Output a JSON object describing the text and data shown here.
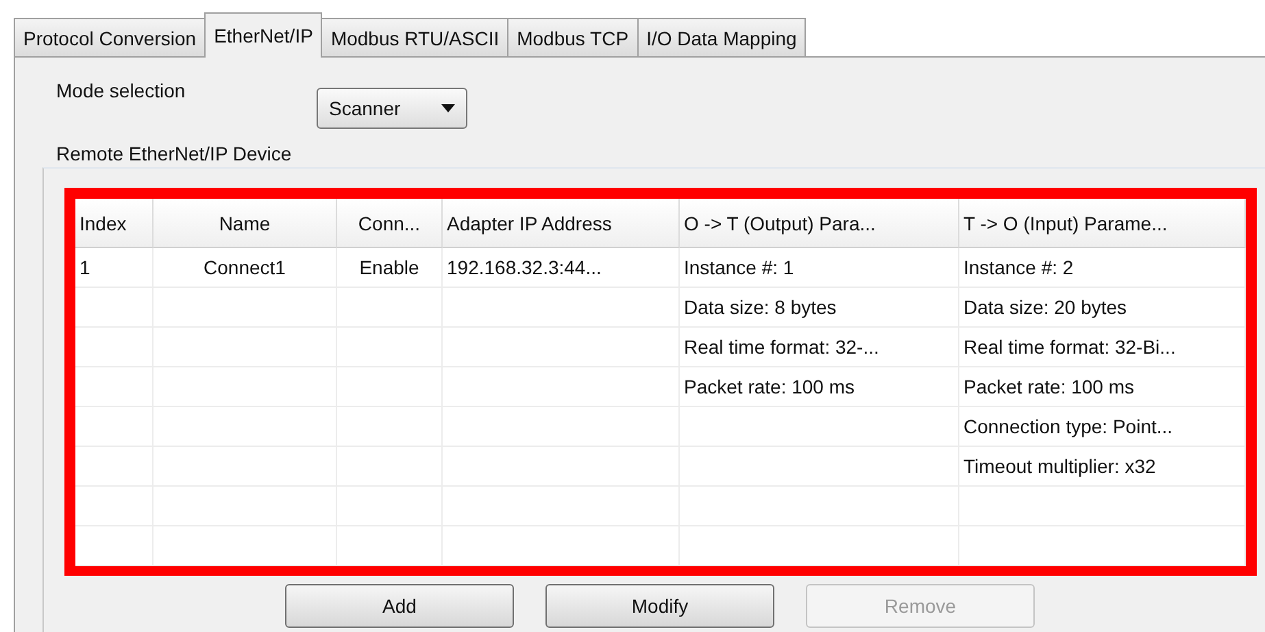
{
  "tabs": [
    {
      "label": "Protocol Conversion",
      "selected": false
    },
    {
      "label": "EtherNet/IP",
      "selected": true
    },
    {
      "label": "Modbus RTU/ASCII",
      "selected": false
    },
    {
      "label": "Modbus TCP",
      "selected": false
    },
    {
      "label": "I/O Data Mapping",
      "selected": false
    }
  ],
  "mode_selection": {
    "label": "Mode selection",
    "value": "Scanner"
  },
  "device_group": {
    "title": "Remote EtherNet/IP Device",
    "table": {
      "columns": [
        "Index",
        "Name",
        "Conn...",
        "Adapter IP Address",
        "O -> T (Output) Para...",
        "T -> O (Input) Parame..."
      ],
      "rows": [
        {
          "index": "1",
          "name": "Connect1",
          "connection": "Enable",
          "adapter_ip": "192.168.32.3:44...",
          "output_params": "Instance #: 1",
          "input_params": "Instance #: 2"
        },
        {
          "output_params": "Data size: 8 bytes",
          "input_params": "Data size: 20 bytes"
        },
        {
          "output_params": "Real time format: 32-...",
          "input_params": "Real time format: 32-Bi..."
        },
        {
          "output_params": "Packet rate: 100 ms",
          "input_params": "Packet rate: 100 ms"
        },
        {
          "input_params": "Connection type: Point..."
        },
        {
          "input_params": "Timeout multiplier: x32"
        }
      ]
    }
  },
  "buttons": [
    {
      "label": "Add",
      "disabled": false
    },
    {
      "label": "Modify",
      "disabled": false
    },
    {
      "label": "Remove",
      "disabled": true
    }
  ]
}
